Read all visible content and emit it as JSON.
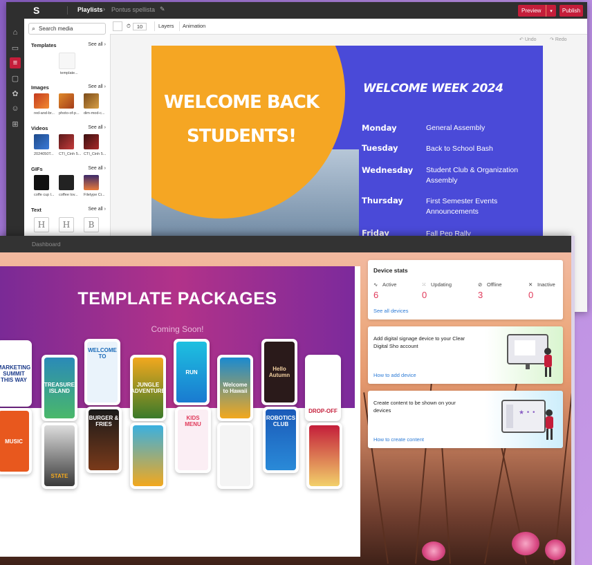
{
  "editor": {
    "breadcrumb": [
      "Playlists",
      "Pontus spellista"
    ],
    "breadcrumb_sep": "›",
    "preview_label": "Preview",
    "publish_label": "Publish",
    "search_placeholder": "Search media",
    "sections": [
      {
        "title": "Templates",
        "see_all": "See all ›",
        "items": [
          "template..."
        ]
      },
      {
        "title": "Images",
        "see_all": "See all ›",
        "items": [
          "red-and-br...",
          "photo-of-p...",
          "dim-mod-c..."
        ]
      },
      {
        "title": "Videos",
        "see_all": "See all ›",
        "items": [
          "2024050T...",
          "CTI_Cinh 5...",
          "CTI_Cinh 5..."
        ]
      },
      {
        "title": "GIFs",
        "see_all": "See all ›",
        "items": [
          "coffe cup l...",
          "coffee lov...",
          "Filetype Ci..."
        ]
      },
      {
        "title": "Text",
        "see_all": "See all ›",
        "items": [
          "H",
          "H",
          "B"
        ]
      }
    ],
    "duration": "10",
    "tabs": [
      "Layers",
      "Animation"
    ],
    "undo_label": "Undo",
    "redo_label": "Redo",
    "slide": {
      "headline": "WELCOME BACK STUDENTS!",
      "week_title": "WELCOME WEEK 2024",
      "schedule": [
        {
          "day": "Monday",
          "event": "General Assembly"
        },
        {
          "day": "Tuesday",
          "event": "Back to School Bash"
        },
        {
          "day": "Wednesday",
          "event": "Student Club & Organization Assembly"
        },
        {
          "day": "Thursday",
          "event": "First Semester Events Announcements"
        },
        {
          "day": "Friday",
          "event": "Fall Pep Rally"
        }
      ]
    },
    "colors": {
      "accent": "#c41e3a",
      "slide_blue": "#4a4ad8",
      "slide_orange": "#f5a623"
    }
  },
  "dashboard": {
    "title": "Dashboard",
    "packages": {
      "title": "TEMPLATE PACKAGES",
      "subtitle": "Coming Soon!",
      "phones": [
        {
          "text": "MARKETING SUMMIT THIS WAY"
        },
        {
          "text": "TREASURE ISLAND"
        },
        {
          "text": "WELCOME TO"
        },
        {
          "text": "JUNGLE ADVENTURE"
        },
        {
          "text": "RUN"
        },
        {
          "text": "Welcome to Hawaii"
        },
        {
          "text": "Hello Autumn"
        },
        {
          "text": "DROP-OFF"
        },
        {
          "text": "MUSIC"
        },
        {
          "text": "STATE"
        },
        {
          "text": "BURGER & FRIES"
        },
        {
          "text": ""
        },
        {
          "text": "KIDS MENU"
        },
        {
          "text": ""
        },
        {
          "text": "ROBOTICS CLUB"
        },
        {
          "text": ""
        }
      ]
    },
    "device_stats": {
      "title": "Device stats",
      "stats": [
        {
          "label": "Active",
          "value": "6",
          "icon": "activity-icon"
        },
        {
          "label": "Updating",
          "value": "0",
          "icon": "loading-icon"
        },
        {
          "label": "Offline",
          "value": "3",
          "icon": "wifi-off-icon"
        },
        {
          "label": "Inactive",
          "value": "0",
          "icon": "close-icon"
        }
      ],
      "link": "See all devices"
    },
    "add_device": {
      "text": "Add digital signage device to your Clear Digital Sho account",
      "link": "How to add device"
    },
    "create_content": {
      "text": "Create content to be shown on your devices",
      "link": "How to create content"
    }
  }
}
